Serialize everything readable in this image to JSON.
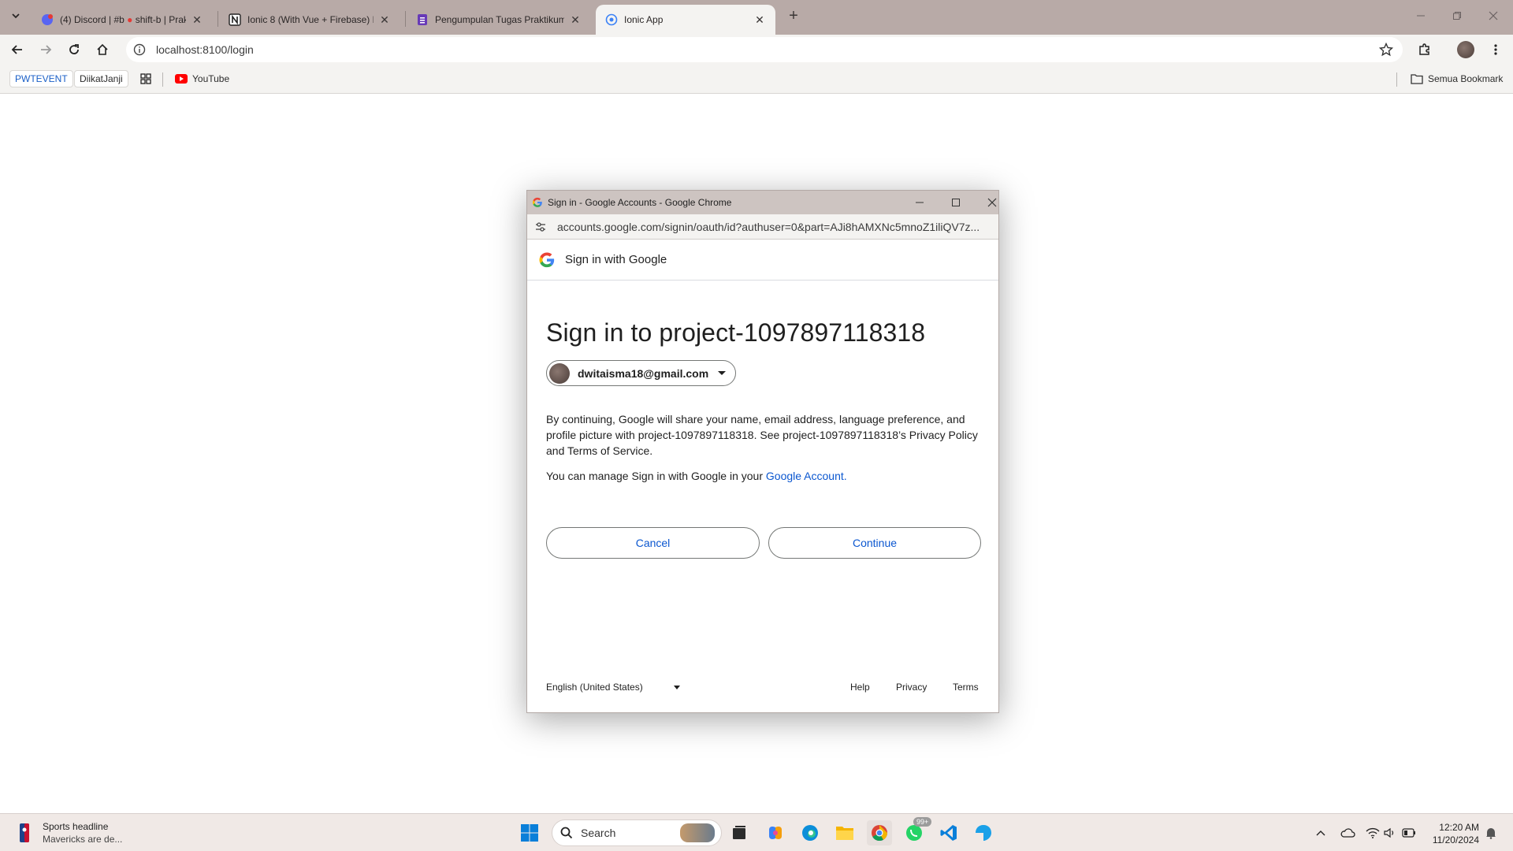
{
  "browser": {
    "tabs": [
      {
        "title": "(4) Discord | #b",
        "suffix": "shift-b | Prak",
        "favicon": "discord-icon",
        "active": false
      },
      {
        "title": "Ionic 8 (With Vue + Firebase) B",
        "favicon": "notion-icon",
        "active": false
      },
      {
        "title": "Pengumpulan Tugas Praktikum",
        "favicon": "forms-icon",
        "active": false
      },
      {
        "title": "Ionic App",
        "favicon": "globe-icon",
        "active": true
      }
    ],
    "url": "localhost:8100/login",
    "bookmarks": [
      {
        "label": "PWTEVENT"
      },
      {
        "label": "DiikatJanji"
      },
      {
        "label": "YouTube"
      }
    ],
    "all_bookmarks_label": "Semua Bookmark"
  },
  "popup": {
    "window_title": "Sign in - Google Accounts - Google Chrome",
    "url": "accounts.google.com/signin/oauth/id?authuser=0&part=AJi8hAMXNc5mnoZ1iliQV7z...",
    "header": "Sign in with Google",
    "heading": "Sign in to project-1097897118318",
    "account_email": "dwitaisma18@gmail.com",
    "disclaimer": "By continuing, Google will share your name, email address, language preference, and profile picture with project-1097897118318. See project-1097897118318’s Privacy Policy and Terms of Service.",
    "manage_prefix": "You can manage Sign in with Google in your ",
    "manage_link": "Google Account.",
    "cancel_label": "Cancel",
    "continue_label": "Continue",
    "language": "English (United States)",
    "footer_links": {
      "help": "Help",
      "privacy": "Privacy",
      "terms": "Terms"
    }
  },
  "taskbar": {
    "news_title": "Sports headline",
    "news_subtitle": "Mavericks are de...",
    "search_placeholder": "Search",
    "badge": "99+",
    "time": "12:20 AM",
    "date": "11/20/2024"
  },
  "colors": {
    "link_blue": "#0b57d0",
    "tabstrip": "#b8aaa7",
    "toolbar": "#f4f3f1"
  }
}
